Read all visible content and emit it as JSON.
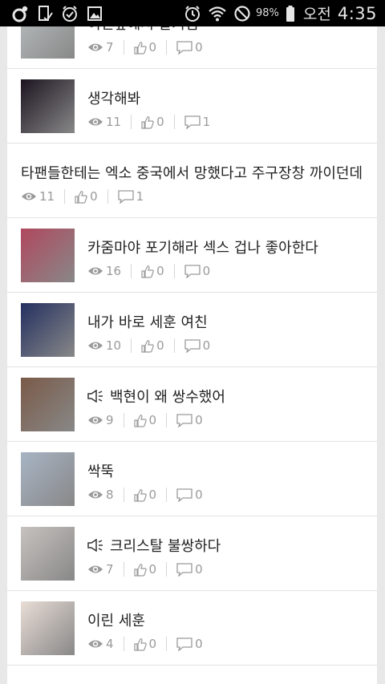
{
  "status_bar": {
    "battery": "98%",
    "ampm": "오전",
    "time": "4:35",
    "icons": [
      "notification-icon",
      "screenshot-icon",
      "alarm-check-icon",
      "image-icon",
      "alarm-icon",
      "wifi-icon",
      "blocked-icon"
    ]
  },
  "posts": [
    {
      "title": "여친앞에서 발기잼",
      "views": "7",
      "likes": "0",
      "comments": "0",
      "has_thumb": true,
      "speaker": false,
      "thumb_color": "#b9bfc0"
    },
    {
      "title": "생각해봐",
      "views": "11",
      "likes": "0",
      "comments": "1",
      "has_thumb": true,
      "speaker": false,
      "thumb_color": "#1c1420"
    },
    {
      "title": "타팬들한테는 엑소 중국에서 망했다고 주구장창 까이던데",
      "views": "11",
      "likes": "0",
      "comments": "1",
      "has_thumb": false,
      "speaker": false
    },
    {
      "title": "카줌마야 포기해라 섹스 겁나 좋아한다",
      "views": "16",
      "likes": "0",
      "comments": "0",
      "has_thumb": true,
      "speaker": false,
      "thumb_color": "#b0485e"
    },
    {
      "title": "내가 바로 세훈 여친",
      "views": "10",
      "likes": "0",
      "comments": "0",
      "has_thumb": true,
      "speaker": false,
      "thumb_color": "#243060"
    },
    {
      "title": "백현이 왜 쌍수했어",
      "views": "9",
      "likes": "0",
      "comments": "0",
      "has_thumb": true,
      "speaker": true,
      "thumb_color": "#7a5a48"
    },
    {
      "title": "싹뚝",
      "views": "8",
      "likes": "0",
      "comments": "0",
      "has_thumb": true,
      "speaker": false,
      "thumb_color": "#a8b4c4"
    },
    {
      "title": "크리스탈 불쌍하다",
      "views": "7",
      "likes": "0",
      "comments": "0",
      "has_thumb": true,
      "speaker": true,
      "thumb_color": "#c7c2bf"
    },
    {
      "title": "이린 세훈",
      "views": "4",
      "likes": "0",
      "comments": "0",
      "has_thumb": true,
      "speaker": false,
      "thumb_color": "#e9ddd6"
    }
  ]
}
